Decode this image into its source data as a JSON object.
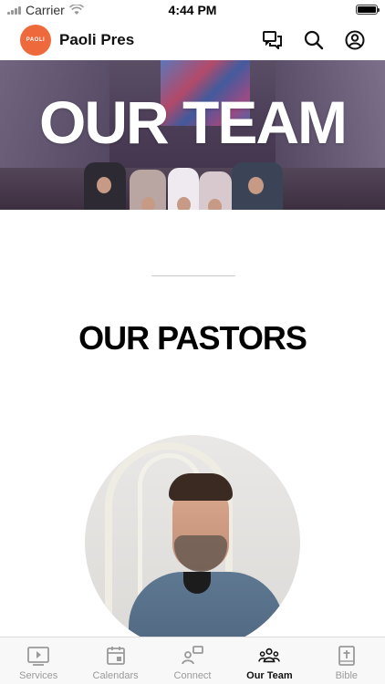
{
  "status_bar": {
    "carrier": "Carrier",
    "time": "4:44 PM"
  },
  "header": {
    "logo_text": "PAOLI",
    "title": "Paoli Pres",
    "icons": [
      "chat-icon",
      "search-icon",
      "profile-icon"
    ]
  },
  "hero": {
    "title": "OUR TEAM"
  },
  "section": {
    "title": "OUR PASTORS"
  },
  "tabs": [
    {
      "label": "Services",
      "icon": "play-icon",
      "active": false
    },
    {
      "label": "Calendars",
      "icon": "calendar-icon",
      "active": false
    },
    {
      "label": "Connect",
      "icon": "connect-icon",
      "active": false
    },
    {
      "label": "Our Team",
      "icon": "team-icon",
      "active": true
    },
    {
      "label": "Bible",
      "icon": "bible-icon",
      "active": false
    }
  ],
  "colors": {
    "brand": "#ee6a3c",
    "tab_active": "#111111",
    "tab_inactive": "#9a9a9a"
  }
}
